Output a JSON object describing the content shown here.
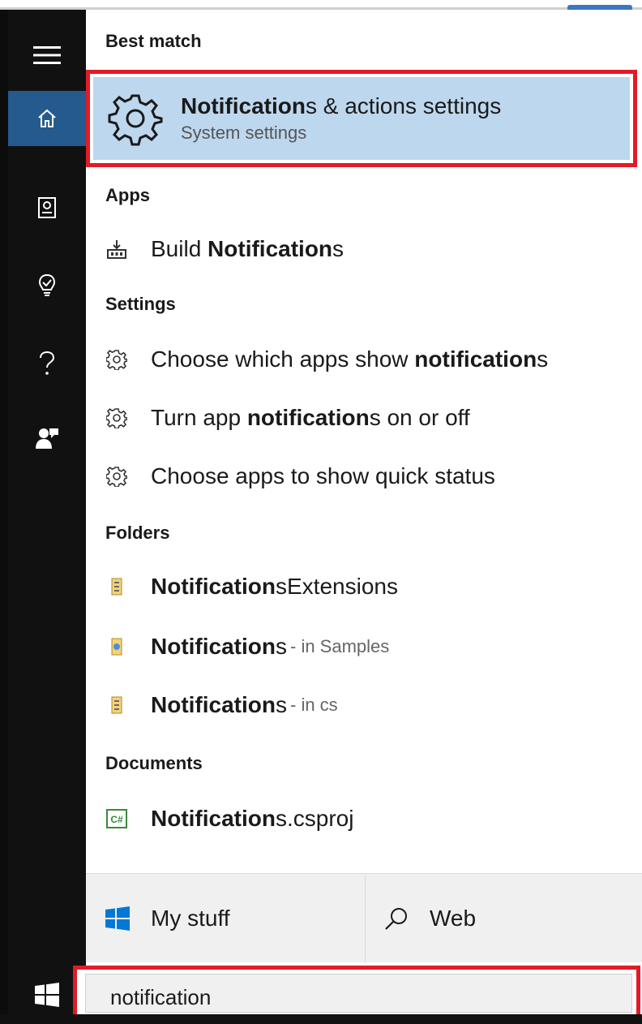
{
  "rail": {
    "items": [
      {
        "name": "hamburger-icon"
      },
      {
        "name": "home-icon"
      },
      {
        "name": "notebook-icon"
      },
      {
        "name": "lightbulb-icon"
      },
      {
        "name": "help-icon"
      },
      {
        "name": "feedback-icon"
      }
    ]
  },
  "sections": {
    "best_match": "Best match",
    "apps": "Apps",
    "settings": "Settings",
    "folders": "Folders",
    "documents": "Documents"
  },
  "best_match": {
    "title_bold": "Notification",
    "title_rest": "s & actions settings",
    "subtitle": "System settings",
    "icon": "gear-icon"
  },
  "apps": [
    {
      "pre": "Build ",
      "bold": "Notification",
      "post": "s",
      "icon": "build-app-icon"
    }
  ],
  "settings": [
    {
      "pre": "Choose which apps show ",
      "bold": "notification",
      "post": "s",
      "icon": "gear-icon"
    },
    {
      "pre": "Turn app ",
      "bold": "notification",
      "post": "s on or off",
      "icon": "gear-icon"
    },
    {
      "pre": "Choose apps to show quick status",
      "bold": "",
      "post": "",
      "icon": "gear-icon"
    }
  ],
  "folders": [
    {
      "bold": "Notification",
      "post": "sExtensions",
      "sub": "",
      "icon": "folder-icon"
    },
    {
      "bold": "Notification",
      "post": "s",
      "sub": "- in Samples",
      "icon": "folder-icon"
    },
    {
      "bold": "Notification",
      "post": "s",
      "sub": "- in cs",
      "icon": "folder-icon"
    }
  ],
  "documents": [
    {
      "bold": "Notification",
      "post": "s.csproj",
      "icon": "csharp-file-icon"
    }
  ],
  "filters": {
    "mystuff": "My stuff",
    "web": "Web"
  },
  "search": {
    "value": "notification"
  },
  "colors": {
    "accent": "#245a8e",
    "highlight": "#bdd7ee",
    "annotation_red": "#e21b26",
    "windows_blue": "#0078d7"
  }
}
